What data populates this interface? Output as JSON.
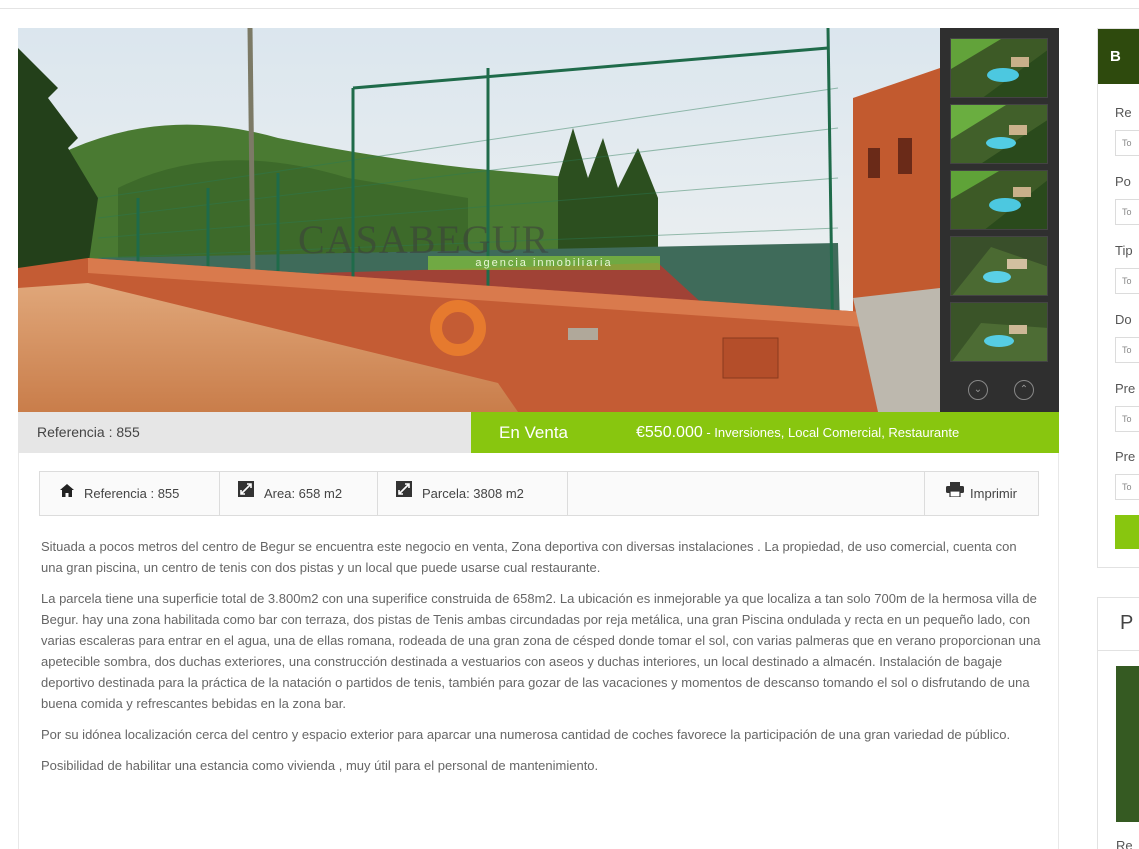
{
  "listing": {
    "reference_label": "Referencia : 855",
    "status": "En Venta",
    "price": "€550.000",
    "types": " - Inversiones, Local Comercial, Restaurante"
  },
  "gallery": {
    "watermark": "CASABEGUR",
    "watermark_sub": "agencia inmobiliaria",
    "thumbnail_count": 5,
    "prev_icon": "chevron-down-circle-icon",
    "next_icon": "chevron-up-circle-icon"
  },
  "features": {
    "reference": "Referencia : 855",
    "area": "Area: 658 m2",
    "parcela": "Parcela: 3808 m2",
    "print": "Imprimir",
    "icons": [
      "home-icon",
      "resize-icon",
      "resize-icon",
      "printer-icon"
    ]
  },
  "description": [
    "Situada a pocos metros del centro de Begur se encuentra este negocio en venta, Zona deportiva con diversas instalaciones . La propiedad, de uso comercial, cuenta con una gran piscina, un centro de tenis con dos pistas y un local que puede usarse cual restaurante.",
    "La parcela tiene una superficie total de 3.800m2 con una superifice construida de 658m2. La ubicación es inmejorable ya que localiza a tan solo 700m de la hermosa villa de Begur. hay una zona habilitada como bar con terraza,  dos pistas de Tenis ambas circundadas por reja metálica, una gran Piscina ondulada y recta en un pequeño lado, con varias escaleras para entrar en el agua, una de ellas romana,  rodeada de una gran zona de césped donde tomar el sol, con varias palmeras que en verano proporcionan una apetecible sombra,  dos duchas exteriores,  una construcción destinada a vestuarios con aseos y duchas interiores, un local destinado a almacén.  Instalación de bagaje deportivo destinada para la práctica de la natación o partidos de tenis, también para gozar de las vacaciones y momentos de descanso tomando el sol o disfrutando de una buena comida y refrescantes bebidas en la zona bar.",
    "Por su idónea  localización cerca del centro y espacio exterior para aparcar una numerosa cantidad de coches favorece la participación de una gran variedad de público.",
    "Posibilidad de habilitar una estancia como vivienda , muy útil para el personal de mantenimiento."
  ],
  "sidebar": {
    "search_head": "B",
    "labels": [
      "Re",
      "Po",
      "Tip",
      "Do",
      "Pre",
      "Pre"
    ],
    "input_text": "To",
    "props_head": "P",
    "props_label": "Re"
  },
  "colors": {
    "accent": "#88c60f",
    "dark_green": "#2e4a0d",
    "gallery_bg": "#2f2f2f"
  }
}
